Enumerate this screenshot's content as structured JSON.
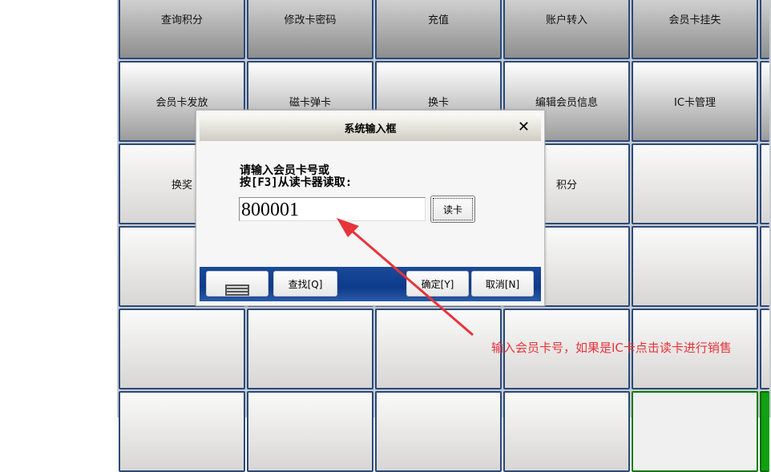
{
  "grid": {
    "rows": [
      [
        "查询积分",
        "修改卡密码",
        "充值",
        "账户转入",
        "会员卡挂失",
        ""
      ],
      [
        "会员卡发放",
        "磁卡弹卡",
        "换卡",
        "编辑会员信息",
        "IC卡管理",
        ""
      ],
      [
        "换奖",
        "",
        "",
        "积分",
        "",
        ""
      ],
      [
        "",
        "",
        "",
        "",
        "",
        ""
      ],
      [
        "",
        "",
        "",
        "",
        "",
        ""
      ],
      [
        "",
        "",
        "",
        "",
        "",
        ""
      ]
    ]
  },
  "dialog": {
    "title": "系统输入框",
    "close": "✕",
    "prompt_line1": "请输入会员卡号或",
    "prompt_line2": "按[F3]从读卡器读取:",
    "card_value": "800001",
    "read_card": "读卡",
    "find": "查找[Q]",
    "ok": "确定[Y]",
    "cancel": "取消[N]"
  },
  "annotation": "输入会员卡号，如果是IC卡点击读卡进行销售",
  "colors": {
    "arrow": "#e8333a",
    "footer": "#0e3a8a"
  }
}
